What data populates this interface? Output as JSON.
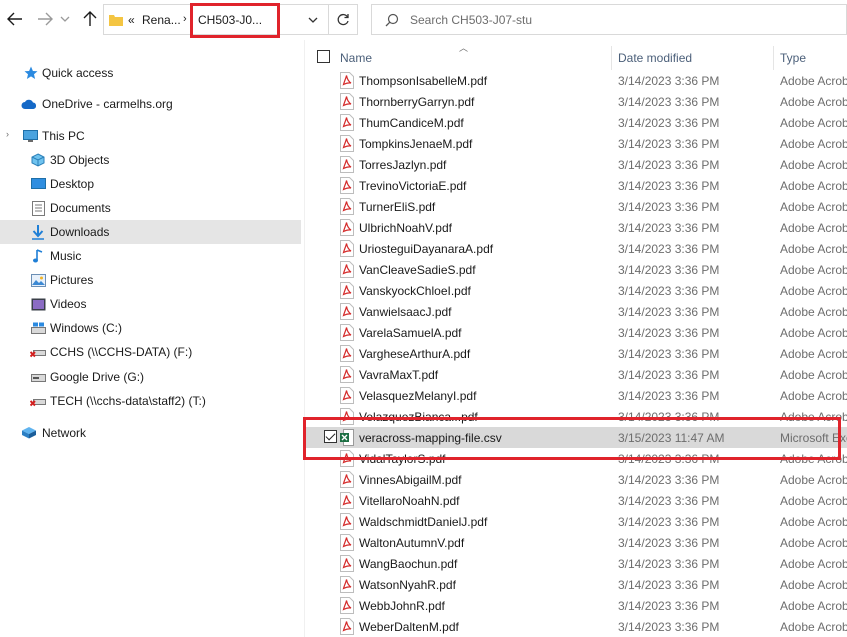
{
  "toolbar": {
    "address": {
      "segments": [
        "Rena...",
        "CH503-J0..."
      ],
      "overflow": "«"
    },
    "search": {
      "placeholder": "Search CH503-J07-stu"
    }
  },
  "sidebar": {
    "items": [
      {
        "label": "Quick access",
        "icon": "star-icon"
      },
      {
        "label": "OneDrive - carmelhs.org",
        "icon": "cloud-icon"
      },
      {
        "label": "This PC",
        "icon": "computer-icon"
      },
      {
        "label": "3D Objects",
        "icon": "cube-icon"
      },
      {
        "label": "Desktop",
        "icon": "desktop-icon"
      },
      {
        "label": "Documents",
        "icon": "documents-icon"
      },
      {
        "label": "Downloads",
        "icon": "download-icon",
        "selected": true
      },
      {
        "label": "Music",
        "icon": "music-icon"
      },
      {
        "label": "Pictures",
        "icon": "pictures-icon"
      },
      {
        "label": "Videos",
        "icon": "videos-icon"
      },
      {
        "label": "Windows (C:)",
        "icon": "drive-icon"
      },
      {
        "label": "CCHS (\\\\CCHS-DATA) (F:)",
        "icon": "network-drive-disconnected-icon"
      },
      {
        "label": "Google Drive (G:)",
        "icon": "drive-icon"
      },
      {
        "label": "TECH (\\\\cchs-data\\staff2) (T:)",
        "icon": "network-drive-disconnected-icon"
      },
      {
        "label": "Network",
        "icon": "network-icon"
      }
    ]
  },
  "columns": {
    "name": "Name",
    "date": "Date modified",
    "type": "Type"
  },
  "files": [
    {
      "name": "ThompsonIsabelleM.pdf",
      "date": "3/14/2023 3:36 PM",
      "type": "Adobe Acrobat Document"
    },
    {
      "name": "ThornberryGarryn.pdf",
      "date": "3/14/2023 3:36 PM",
      "type": "Adobe Acrobat Document"
    },
    {
      "name": "ThumCandiceM.pdf",
      "date": "3/14/2023 3:36 PM",
      "type": "Adobe Acrobat Document"
    },
    {
      "name": "TompkinsJenaeM.pdf",
      "date": "3/14/2023 3:36 PM",
      "type": "Adobe Acrobat Document"
    },
    {
      "name": "TorresJazlyn.pdf",
      "date": "3/14/2023 3:36 PM",
      "type": "Adobe Acrobat Document"
    },
    {
      "name": "TrevinoVictoriaE.pdf",
      "date": "3/14/2023 3:36 PM",
      "type": "Adobe Acrobat Document"
    },
    {
      "name": "TurnerEliS.pdf",
      "date": "3/14/2023 3:36 PM",
      "type": "Adobe Acrobat Document"
    },
    {
      "name": "UlbrichNoahV.pdf",
      "date": "3/14/2023 3:36 PM",
      "type": "Adobe Acrobat Document"
    },
    {
      "name": "UriosteguiDayanaraA.pdf",
      "date": "3/14/2023 3:36 PM",
      "type": "Adobe Acrobat Document"
    },
    {
      "name": "VanCleaveSadieS.pdf",
      "date": "3/14/2023 3:36 PM",
      "type": "Adobe Acrobat Document"
    },
    {
      "name": "VanskyockChloeI.pdf",
      "date": "3/14/2023 3:36 PM",
      "type": "Adobe Acrobat Document"
    },
    {
      "name": "VanwielsaacJ.pdf",
      "date": "3/14/2023 3:36 PM",
      "type": "Adobe Acrobat Document"
    },
    {
      "name": "VarelaSamuelA.pdf",
      "date": "3/14/2023 3:36 PM",
      "type": "Adobe Acrobat Document"
    },
    {
      "name": "VargheseArthurA.pdf",
      "date": "3/14/2023 3:36 PM",
      "type": "Adobe Acrobat Document"
    },
    {
      "name": "VavraMaxT.pdf",
      "date": "3/14/2023 3:36 PM",
      "type": "Adobe Acrobat Document"
    },
    {
      "name": "VelasquezMelanyI.pdf",
      "date": "3/14/2023 3:36 PM",
      "type": "Adobe Acrobat Document"
    },
    {
      "name": "VelazquezBianca...pdf",
      "date": "3/14/2023 3:36 PM",
      "type": "Adobe Acrobat Document"
    },
    {
      "name": "veracross-mapping-file.csv",
      "date": "3/15/2023 11:47 AM",
      "type": "Microsoft Excel Comma Separated Values File",
      "selected": true,
      "kind": "csv"
    },
    {
      "name": "VidalTaylorS.pdf",
      "date": "3/14/2023 3:36 PM",
      "type": "Adobe Acrobat Document"
    },
    {
      "name": "VinnesAbigailM.pdf",
      "date": "3/14/2023 3:36 PM",
      "type": "Adobe Acrobat Document"
    },
    {
      "name": "VitellaroNoahN.pdf",
      "date": "3/14/2023 3:36 PM",
      "type": "Adobe Acrobat Document"
    },
    {
      "name": "WaldschmidtDanielJ.pdf",
      "date": "3/14/2023 3:36 PM",
      "type": "Adobe Acrobat Document"
    },
    {
      "name": "WaltonAutumnV.pdf",
      "date": "3/14/2023 3:36 PM",
      "type": "Adobe Acrobat Document"
    },
    {
      "name": "WangBaochun.pdf",
      "date": "3/14/2023 3:36 PM",
      "type": "Adobe Acrobat Document"
    },
    {
      "name": "WatsonNyahR.pdf",
      "date": "3/14/2023 3:36 PM",
      "type": "Adobe Acrobat Document"
    },
    {
      "name": "WebbJohnR.pdf",
      "date": "3/14/2023 3:36 PM",
      "type": "Adobe Acrobat Document"
    },
    {
      "name": "WeberDaltenM.pdf",
      "date": "3/14/2023 3:36 PM",
      "type": "Adobe Acrobat Document"
    }
  ],
  "colors": {
    "highlight": "#e0232b",
    "selected_row": "#d9d9d9",
    "selected_nav": "#e5e5e5",
    "header_text": "#4c607a",
    "pdf_red": "#d42a2a",
    "excel_green": "#1d7044"
  }
}
